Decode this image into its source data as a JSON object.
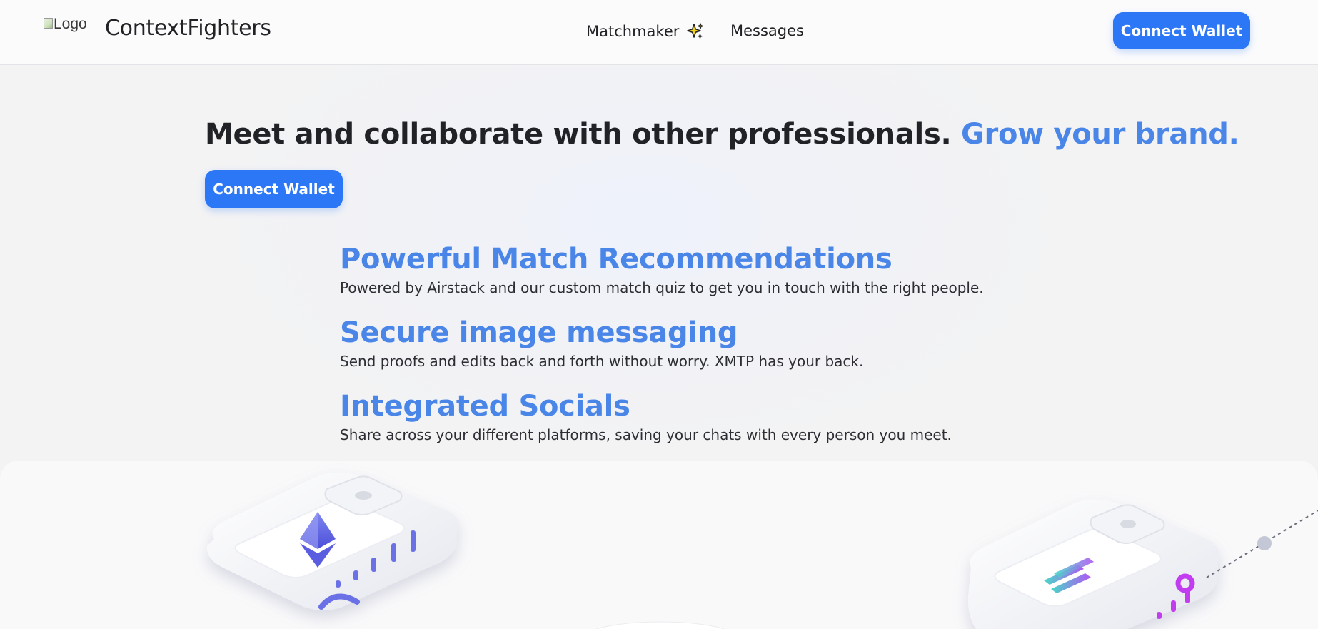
{
  "header": {
    "logo_alt": "Logo",
    "brand": "ContextFighters",
    "nav": {
      "matchmaker": "Matchmaker",
      "matchmaker_icon": "sparkle-icon",
      "messages": "Messages"
    },
    "connect_wallet": "Connect Wallet"
  },
  "hero": {
    "headline": "Meet and collaborate with other professionals.",
    "headline_accent": "Grow your brand.",
    "connect_wallet": "Connect Wallet"
  },
  "features": [
    {
      "title": "Powerful Match Recommendations",
      "description": "Powered by Airstack and our custom match quiz to get you in touch with the right people."
    },
    {
      "title": "Secure image messaging",
      "description": "Send proofs and edits back and forth without worry. XMTP has your back."
    },
    {
      "title": "Integrated Socials",
      "description": "Share across your different platforms, saving your chats with every person you meet."
    }
  ],
  "illustration": {
    "left_coin": "ethereum-icon",
    "right_coin": "solana-icon"
  },
  "colors": {
    "primary": "#2b77f6",
    "accent_text": "#4a86e8",
    "heading": "#202226"
  }
}
